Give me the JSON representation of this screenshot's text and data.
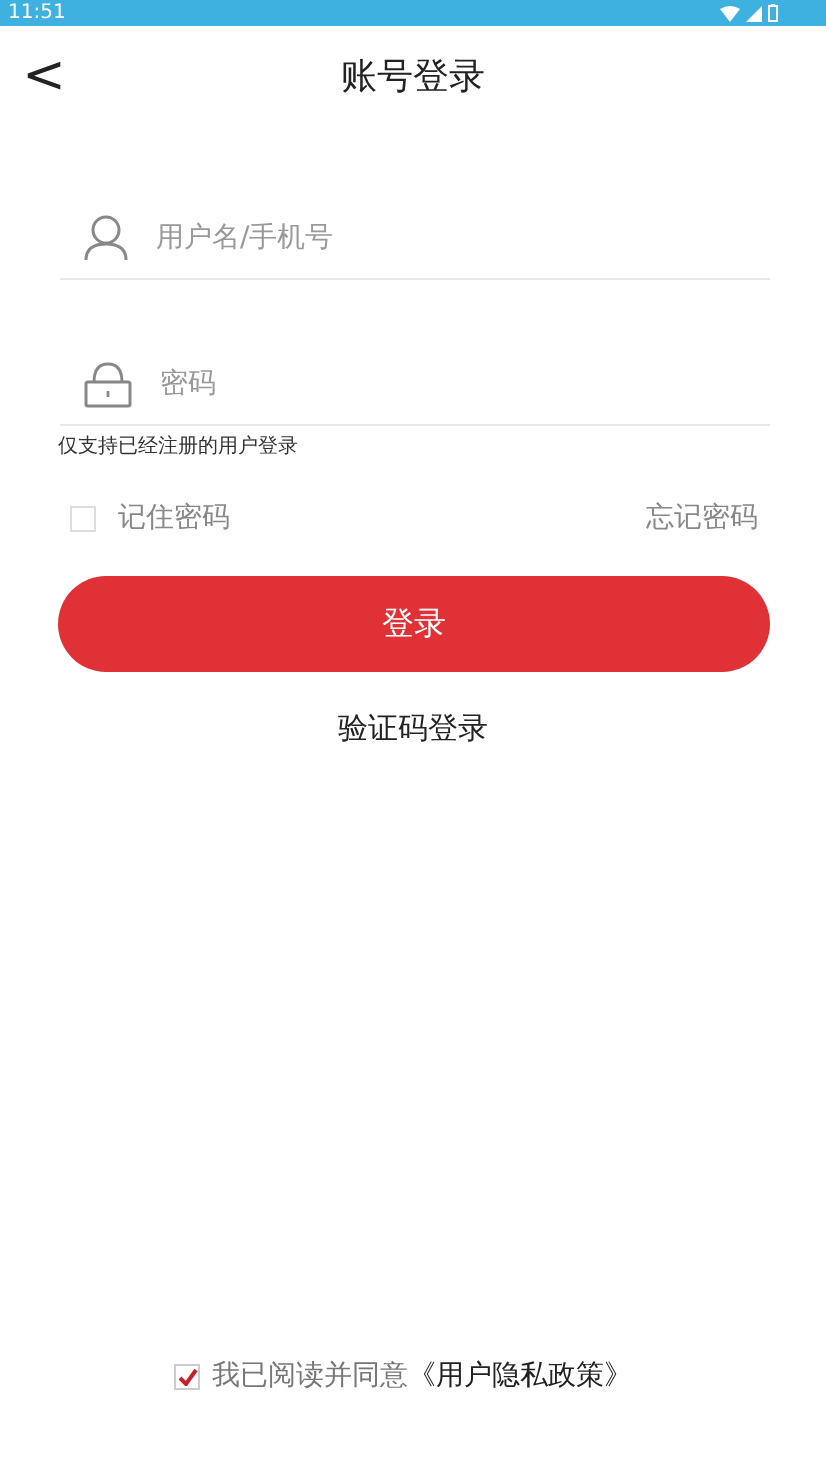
{
  "status_bar": {
    "time": "11:51"
  },
  "header": {
    "back": "<",
    "title": "账号登录"
  },
  "username_field": {
    "placeholder": "用户名/手机号"
  },
  "password_field": {
    "placeholder": "密码"
  },
  "hint": "仅支持已经注册的用户登录",
  "remember_password": {
    "label": "记住密码",
    "checked": false
  },
  "forgot_password": "忘记密码",
  "login_button": "登录",
  "code_login": "验证码登录",
  "agreement": {
    "checked": true,
    "text": "我已阅读并同意",
    "link": "《用户隐私政策》"
  }
}
